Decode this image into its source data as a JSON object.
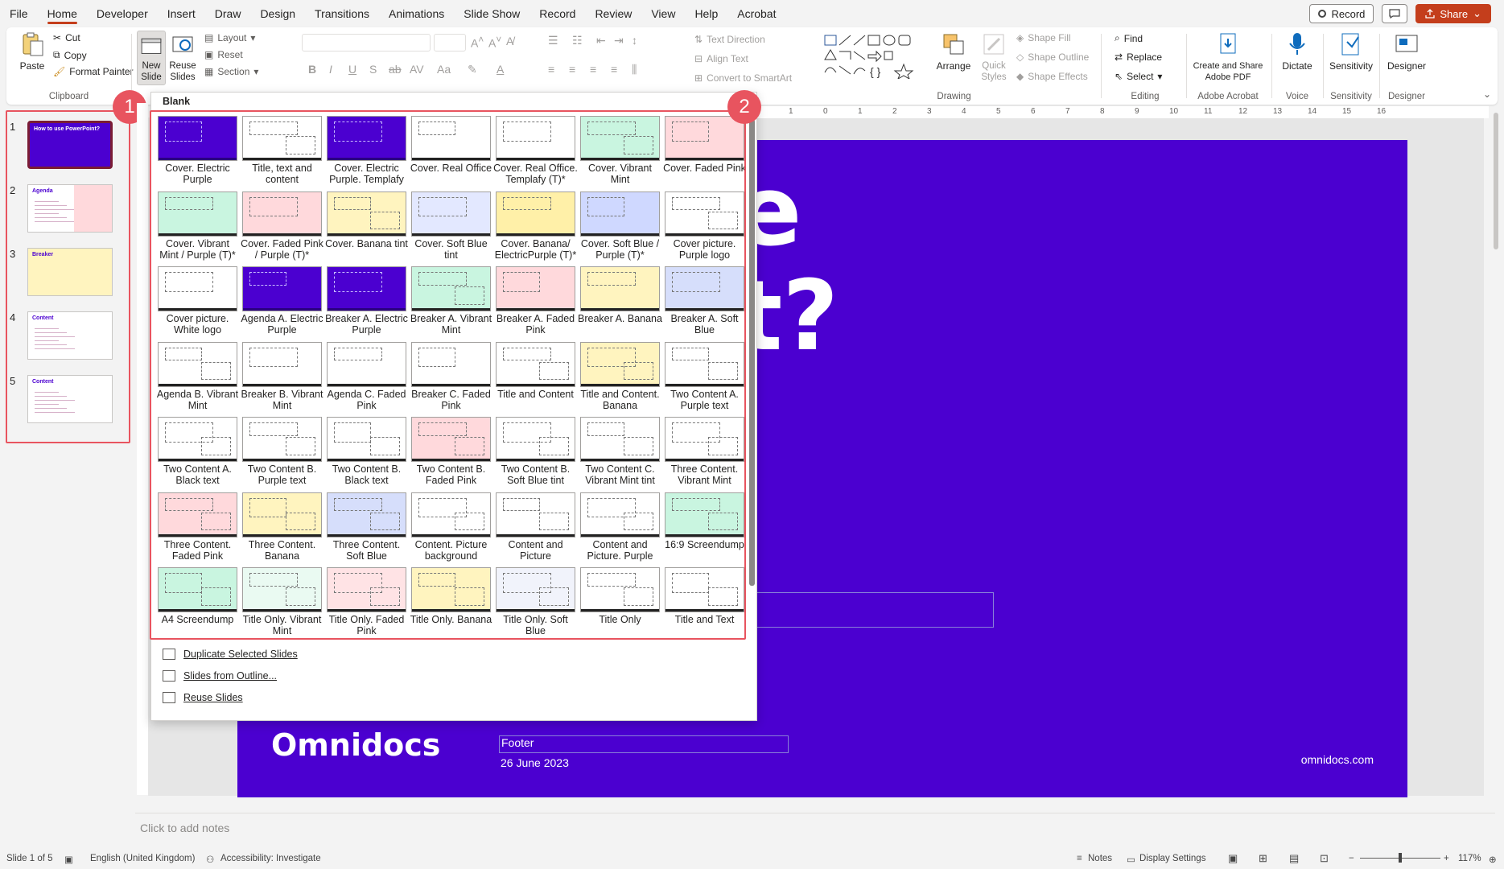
{
  "menu": {
    "tabs": [
      "File",
      "Home",
      "Developer",
      "Insert",
      "Draw",
      "Design",
      "Transitions",
      "Animations",
      "Slide Show",
      "Record",
      "Review",
      "View",
      "Help",
      "Acrobat"
    ],
    "active": "Home",
    "record_label": "Record",
    "share_label": "Share"
  },
  "ribbon": {
    "clipboard": {
      "paste": "Paste",
      "cut": "Cut",
      "copy": "Copy",
      "format_painter": "Format Painter",
      "label": "Clipboard"
    },
    "slides": {
      "new_slide": "New Slide",
      "reuse_slides": "Reuse Slides",
      "layout": "Layout",
      "reset": "Reset",
      "section": "Section"
    },
    "paragraph": {
      "text_direction": "Text Direction",
      "align_text": "Align Text",
      "convert_smartart": "Convert to SmartArt"
    },
    "drawing": {
      "arrange": "Arrange",
      "quick_styles": "Quick Styles",
      "shape_fill": "Shape Fill",
      "shape_outline": "Shape Outline",
      "shape_effects": "Shape Effects",
      "label": "Drawing"
    },
    "editing": {
      "find": "Find",
      "replace": "Replace",
      "select": "Select",
      "label": "Editing"
    },
    "acrobat": {
      "create_share": "Create and Share Adobe PDF",
      "label": "Adobe Acrobat"
    },
    "voice": {
      "dictate": "Dictate",
      "label": "Voice"
    },
    "sensitivity": {
      "btn": "Sensitivity",
      "label": "Sensitivity"
    },
    "designer": {
      "btn": "Designer",
      "label": "Designer"
    }
  },
  "thumbnails": [
    {
      "num": "1",
      "title": "How to use PowerPoint?",
      "bg": "#4b00d0",
      "fg": "#ffffff"
    },
    {
      "num": "2",
      "title": "Agenda",
      "bg": "#ffffff",
      "fg": "#4b00d0"
    },
    {
      "num": "3",
      "title": "Breaker",
      "bg": "#fff4bf",
      "fg": "#4b00d0"
    },
    {
      "num": "4",
      "title": "Content",
      "bg": "#ffffff",
      "fg": "#4b00d0"
    },
    {
      "num": "5",
      "title": "Content",
      "bg": "#ffffff",
      "fg": "#4b00d0"
    }
  ],
  "badges": {
    "one": "1",
    "two": "2"
  },
  "dropdown": {
    "header": "Blank",
    "layouts": [
      {
        "name": "Cover. Electric Purple",
        "bg": "#4b00d0"
      },
      {
        "name": "Title, text and content",
        "bg": "#ffffff"
      },
      {
        "name": "Cover. Electric Purple. Templafy",
        "bg": "#4b00d0"
      },
      {
        "name": "Cover. Real Office",
        "bg": "#ffffff"
      },
      {
        "name": "Cover. Real Office. Templafy (T)*",
        "bg": "#ffffff"
      },
      {
        "name": "Cover. Vibrant Mint",
        "bg": "#c9f5e0"
      },
      {
        "name": "Cover. Faded Pink",
        "bg": "#ffd9dc"
      },
      {
        "name": "Cover. Vibrant Mint / Purple (T)*",
        "bg": "#c9f5e0"
      },
      {
        "name": "Cover. Faded Pink / Purple (T)*",
        "bg": "#ffd9dc"
      },
      {
        "name": "Cover. Banana tint",
        "bg": "#fff4bf"
      },
      {
        "name": "Cover. Soft Blue tint",
        "bg": "#e3e8ff"
      },
      {
        "name": "Cover. Banana/ ElectricPurple (T)*",
        "bg": "#fff0a8"
      },
      {
        "name": "Cover. Soft Blue / Purple (T)*",
        "bg": "#cfd8ff"
      },
      {
        "name": "Cover picture. Purple logo",
        "bg": "#ffffff"
      },
      {
        "name": "Cover picture. White logo",
        "bg": "#ffffff"
      },
      {
        "name": "Agenda A. Electric Purple",
        "bg": "#4b00d0"
      },
      {
        "name": "Breaker A. Electric Purple",
        "bg": "#4b00d0"
      },
      {
        "name": "Breaker A. Vibrant Mint",
        "bg": "#c9f5e0"
      },
      {
        "name": "Breaker A. Faded Pink",
        "bg": "#ffd9dc"
      },
      {
        "name": "Breaker A. Banana",
        "bg": "#fff4bf"
      },
      {
        "name": "Breaker A. Soft Blue",
        "bg": "#d6defb"
      },
      {
        "name": "Agenda B. Vibrant Mint",
        "bg": "#ffffff"
      },
      {
        "name": "Breaker B. Vibrant Mint",
        "bg": "#ffffff"
      },
      {
        "name": "Agenda C. Faded Pink",
        "bg": "#ffffff"
      },
      {
        "name": "Breaker C. Faded Pink",
        "bg": "#ffffff"
      },
      {
        "name": "Title and Content",
        "bg": "#ffffff"
      },
      {
        "name": "Title and Content. Banana",
        "bg": "#fff4bf"
      },
      {
        "name": "Two Content A. Purple text",
        "bg": "#ffffff"
      },
      {
        "name": "Two Content A. Black text",
        "bg": "#ffffff"
      },
      {
        "name": "Two Content B. Purple text",
        "bg": "#ffffff"
      },
      {
        "name": "Two Content B. Black text",
        "bg": "#ffffff"
      },
      {
        "name": "Two Content B. Faded Pink",
        "bg": "#ffd9dc"
      },
      {
        "name": "Two Content B. Soft Blue tint",
        "bg": "#ffffff"
      },
      {
        "name": "Two Content C. Vibrant Mint tint",
        "bg": "#ffffff"
      },
      {
        "name": "Three Content. Vibrant Mint",
        "bg": "#ffffff"
      },
      {
        "name": "Three Content. Faded Pink",
        "bg": "#ffd9dc"
      },
      {
        "name": "Three Content. Banana",
        "bg": "#fff4bf"
      },
      {
        "name": "Three Content. Soft Blue",
        "bg": "#d6defb"
      },
      {
        "name": "Content. Picture background",
        "bg": "#ffffff"
      },
      {
        "name": "Content and Picture",
        "bg": "#ffffff"
      },
      {
        "name": "Content and Picture. Purple",
        "bg": "#ffffff"
      },
      {
        "name": "16:9 Screendump",
        "bg": "#c9f5e0"
      },
      {
        "name": "A4 Screendump",
        "bg": "#c9f5e0"
      },
      {
        "name": "Title Only. Vibrant Mint",
        "bg": "#eafaf2"
      },
      {
        "name": "Title Only. Faded Pink",
        "bg": "#ffe3e5"
      },
      {
        "name": "Title Only. Banana",
        "bg": "#fff4bf"
      },
      {
        "name": "Title Only. Soft Blue",
        "bg": "#f1f3fb"
      },
      {
        "name": "Title Only",
        "bg": "#ffffff"
      },
      {
        "name": "Title and Text",
        "bg": "#ffffff"
      }
    ],
    "menu_items": [
      "Duplicate Selected Slides",
      "Slides from Outline...",
      "Reuse Slides"
    ]
  },
  "slide": {
    "partial_title_1": "e",
    "partial_title_2": "t?",
    "logo": "Omnidocs",
    "footer": "Footer",
    "date": "26 June 2023",
    "url": "omnidocs.com",
    "bg": "#4b00d0"
  },
  "notes_placeholder": "Click to add notes",
  "status": {
    "slide": "Slide 1 of 5",
    "language": "English (United Kingdom)",
    "accessibility": "Accessibility: Investigate",
    "notes": "Notes",
    "display_settings": "Display Settings",
    "zoom": "117%"
  },
  "ruler_marks": [
    "1",
    "0",
    "1",
    "2",
    "3",
    "4",
    "5",
    "6",
    "7",
    "8",
    "9",
    "10",
    "11",
    "12",
    "13",
    "14",
    "15",
    "16"
  ]
}
